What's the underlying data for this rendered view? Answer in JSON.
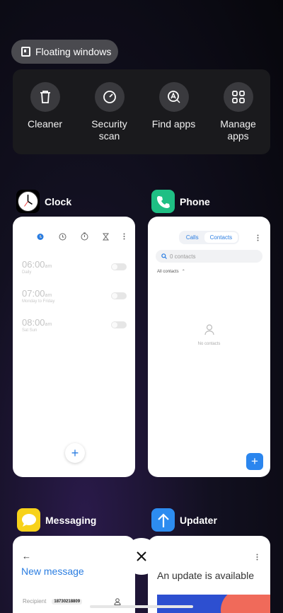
{
  "floating_windows": {
    "label": "Floating windows"
  },
  "quick_actions": [
    {
      "label": "Cleaner",
      "icon": "trash-icon"
    },
    {
      "label": "Security\nscan",
      "icon": "security-icon"
    },
    {
      "label": "Find apps",
      "icon": "find-apps-icon"
    },
    {
      "label": "Manage\napps",
      "icon": "grid-icon"
    }
  ],
  "apps": {
    "clock": {
      "name": "Clock",
      "alarms": [
        {
          "time": "06:00",
          "ampm": "am",
          "repeat": "Daily"
        },
        {
          "time": "07:00",
          "ampm": "am",
          "repeat": "Monday to Friday"
        },
        {
          "time": "08:00",
          "ampm": "am",
          "repeat": "Sat Sun"
        }
      ],
      "add": "+"
    },
    "phone": {
      "name": "Phone",
      "tabs": [
        "Calls",
        "Contacts"
      ],
      "search_placeholder": "0 contacts",
      "filter": "All contacts",
      "empty": "No contacts",
      "add": "+"
    },
    "messaging": {
      "name": "Messaging",
      "title": "New message",
      "recipient_label": "Recipient",
      "recipient_value": "18730218809"
    },
    "updater": {
      "name": "Updater",
      "title": "An update is available"
    }
  },
  "colors": {
    "accent": "#2a7de1",
    "phone_icon": "#1fbf84",
    "messaging_icon": "#f7d21a",
    "updater_icon": "#2d8cf0"
  }
}
